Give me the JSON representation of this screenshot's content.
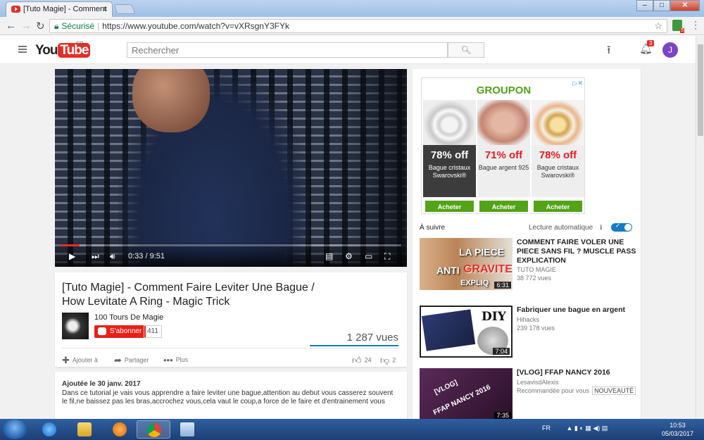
{
  "browser": {
    "tab_title": "[Tuto Magie] - Comment",
    "tab_close": "×",
    "secure_label": "Sécurisé",
    "url": "https://www.youtube.com/watch?v=vXRsgnY3FYk",
    "extension_badge": "5"
  },
  "youtube": {
    "logo_you": "You",
    "logo_tube": "Tube",
    "region": "FR",
    "search_placeholder": "Rechercher",
    "notif_count": "3",
    "avatar_letter": "J"
  },
  "player": {
    "time": "0:33 / 9:51",
    "progress": 0.056
  },
  "video": {
    "title": "[Tuto Magie] - Comment Faire Leviter Une Bague / How Levitate A Ring - Magic Trick",
    "channel": "100 Tours De Magie",
    "subscribe_label": "S'abonner",
    "subscriber_count": "411",
    "views": "1 287 vues",
    "actions": {
      "add_to": "Ajouter à",
      "share": "Partager",
      "more": "Plus",
      "likes": "24",
      "dislikes": "2"
    },
    "published": "Ajoutée le 30 janv. 2017",
    "description": "Dans ce tutorial je vais vous apprendre a faire leviter une bague,attention au debut vous casserez souvent le fil,ne baissez pas les bras,accrochez vous,cela vaut le coup,a force de le faire et d'entrainement vous"
  },
  "ad": {
    "brand": "GROUPON",
    "products": [
      {
        "discount": "78% off",
        "name": "Bague cristaux Swarovski®",
        "button": "Acheter"
      },
      {
        "discount": "71% off",
        "name": "Bague argent 925",
        "button": "Acheter"
      },
      {
        "discount": "78% off",
        "name": "Bague cristaux Swarovski®",
        "button": "Acheter"
      }
    ]
  },
  "sidebar": {
    "up_next": "À suivre",
    "autoplay": "Lecture automatique",
    "related": [
      {
        "title": "COMMENT FAIRE VOLER UNE PIECE SANS FIL ? MUSCLE PASS EXPLICATION",
        "channel": "TUTO MAGIE",
        "meta": "38 772 vues",
        "duration": "6:31",
        "thumb_text": [
          "LA PIECE",
          "ANTI",
          "GRAVITE",
          "EXPLIQ"
        ]
      },
      {
        "title": "Fabriquer une bague en argent",
        "channel": "Hihacks",
        "meta": "239 178 vues",
        "duration": "7:04",
        "thumb_text": [
          "DIY"
        ]
      },
      {
        "title": "[VLOG] FFAP NANCY 2016",
        "channel": "LesavisdAlexis",
        "meta": "Recommandée pour vous",
        "badge": "NOUVEAUTÉ",
        "duration": "7:35",
        "thumb_text": [
          "[VLOG]",
          "FFAP NANCY 2016"
        ]
      }
    ]
  },
  "taskbar": {
    "language": "FR",
    "time": "10:53",
    "date": "05/03/2017"
  }
}
